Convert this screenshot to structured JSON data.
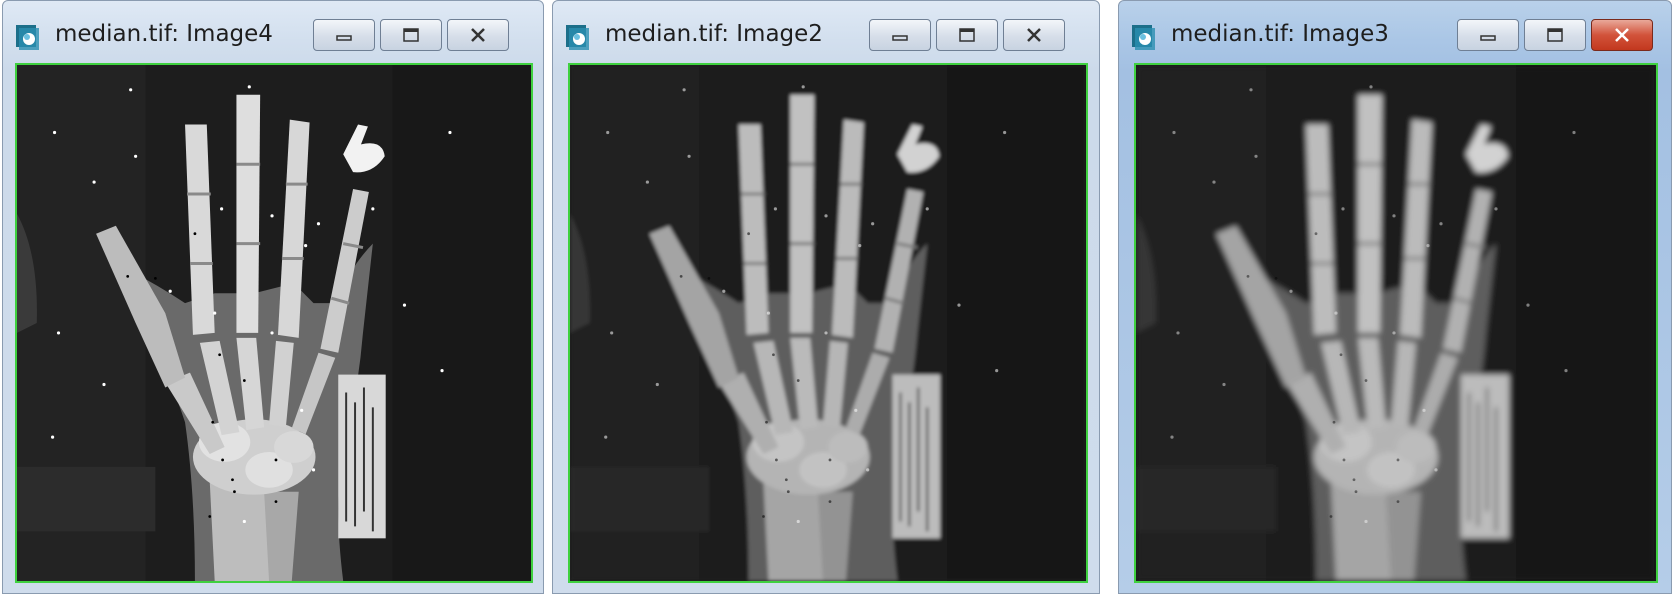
{
  "windows": [
    {
      "title": "median.tif: Image4",
      "active": false
    },
    {
      "title": "median.tif: Image2",
      "active": false
    },
    {
      "title": "median.tif: Image3",
      "active": true
    }
  ],
  "icons": {
    "app": "imagej-app-icon",
    "minimize": "minimize-icon",
    "maximize": "maximize-icon",
    "close": "close-icon"
  },
  "colors": {
    "selection_border": "#3fd13f",
    "active_close": "#c8402a"
  },
  "image_content": "hand x-ray with salt noise"
}
